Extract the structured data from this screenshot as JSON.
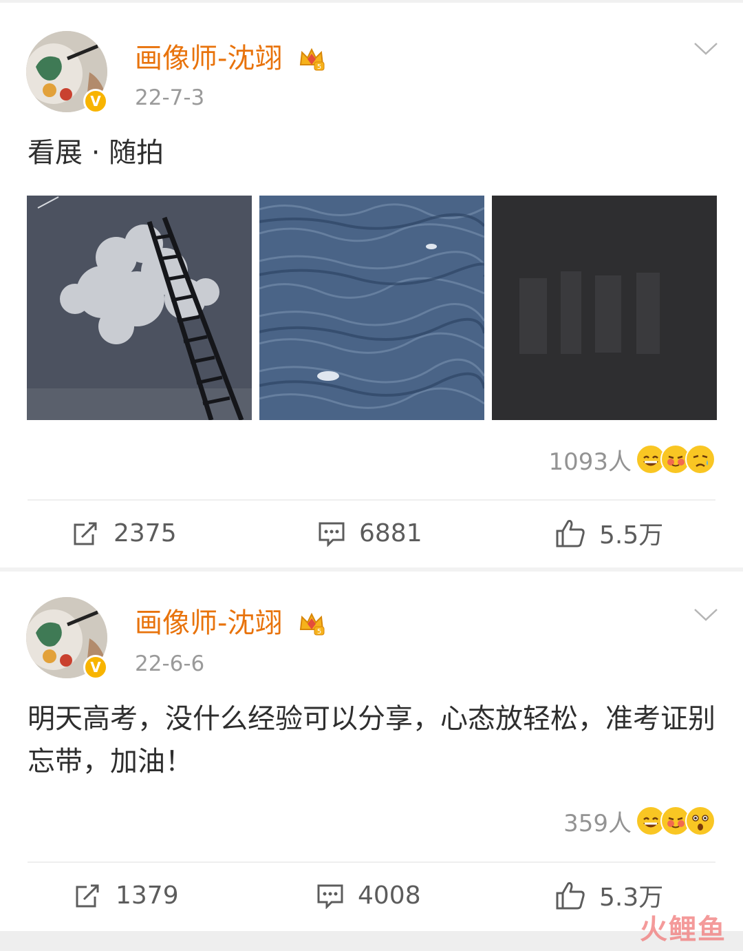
{
  "posts": [
    {
      "username": "画像师-沈翊",
      "date": "22-7-3",
      "content": "看展 · 随拍",
      "reactions": {
        "count": "1093人"
      },
      "actions": {
        "repost": "2375",
        "comment": "6881",
        "like": "5.5万"
      },
      "vip_level": "5"
    },
    {
      "username": "画像师-沈翊",
      "date": "22-6-6",
      "content": "明天高考，没什么经验可以分享，心态放轻松，准考证别忘带，加油！",
      "reactions": {
        "count": "359人"
      },
      "actions": {
        "repost": "1379",
        "comment": "4008",
        "like": "5.3万"
      },
      "vip_level": "5"
    }
  ],
  "watermark": "火鲤鱼",
  "colors": {
    "username": "#e8730c",
    "badge": "#f8b400",
    "meta": "#9a9a9a"
  }
}
